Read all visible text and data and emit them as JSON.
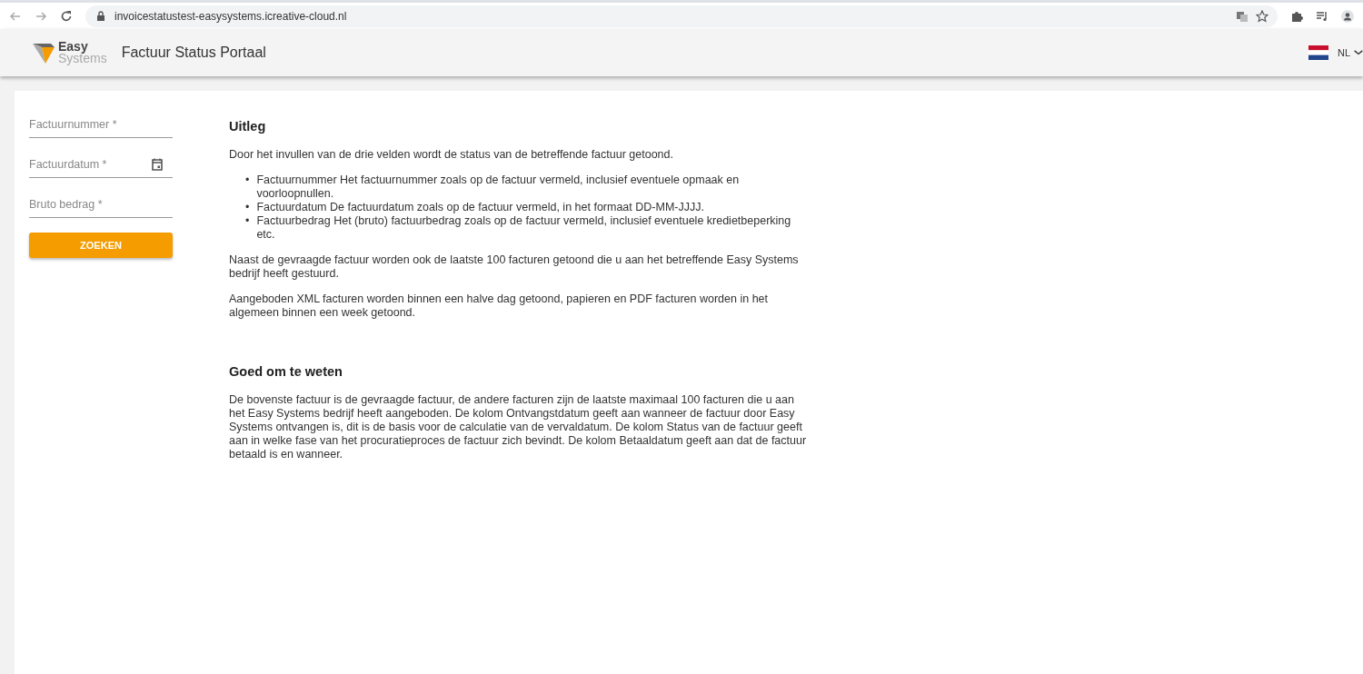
{
  "browser": {
    "url": "invoicestatustest-easysystems.icreative-cloud.nl"
  },
  "header": {
    "logo": [
      "Easy",
      "Systems"
    ],
    "title": "Factuur Status Portaal",
    "language": "NL"
  },
  "form": {
    "fields": [
      {
        "kind": "text",
        "placeholder": "Factuurnummer *"
      },
      {
        "kind": "date",
        "placeholder": "Factuurdatum *"
      },
      {
        "kind": "text",
        "placeholder": "Bruto bedrag *"
      }
    ],
    "button": "ZOEKEN"
  },
  "sections": [
    {
      "title": "Uitleg",
      "blocks": [
        {
          "kind": "paragraph",
          "text": "Door het invullen van de drie velden wordt de status van de betreffende factuur getoond."
        },
        {
          "kind": "list",
          "items": [
            {
              "marker": "•",
              "text": "Factuurnummer Het factuurnummer zoals op de factuur vermeld, inclusief eventuele opmaak en voorloopnullen."
            },
            {
              "marker": "•",
              "text": "Factuurdatum De factuurdatum zoals op de factuur vermeld, in het formaat DD-MM-JJJJ."
            },
            {
              "marker": "•",
              "text": "Factuurbedrag Het (bruto) factuurbedrag zoals op de factuur vermeld, inclusief eventuele kredietbeperking etc."
            }
          ]
        },
        {
          "kind": "paragraph",
          "text": "Naast de gevraagde factuur worden ook de laatste 100 facturen getoond die u aan het betreffende Easy Systems bedrijf heeft gestuurd."
        },
        {
          "kind": "paragraph",
          "text": "Aangeboden XML facturen worden binnen een halve dag getoond, papieren en PDF facturen worden in het algemeen binnen een week getoond."
        }
      ]
    },
    {
      "title": "Goed om te weten",
      "blocks": [
        {
          "kind": "paragraph",
          "text": "De bovenste factuur is de gevraagde factuur, de andere facturen zijn de laatste maximaal 100 facturen die u aan het Easy Systems bedrijf heeft aangeboden. De kolom Ontvangstdatum geeft aan wanneer de factuur door Easy Systems ontvangen is, dit is de basis voor de calculatie van de vervaldatum. De kolom Status van de factuur geeft aan in welke fase van het procuratieproces de factuur zich bevindt. De kolom Betaaldatum geeft aan dat de factuur betaald is en wanneer."
        }
      ]
    }
  ]
}
